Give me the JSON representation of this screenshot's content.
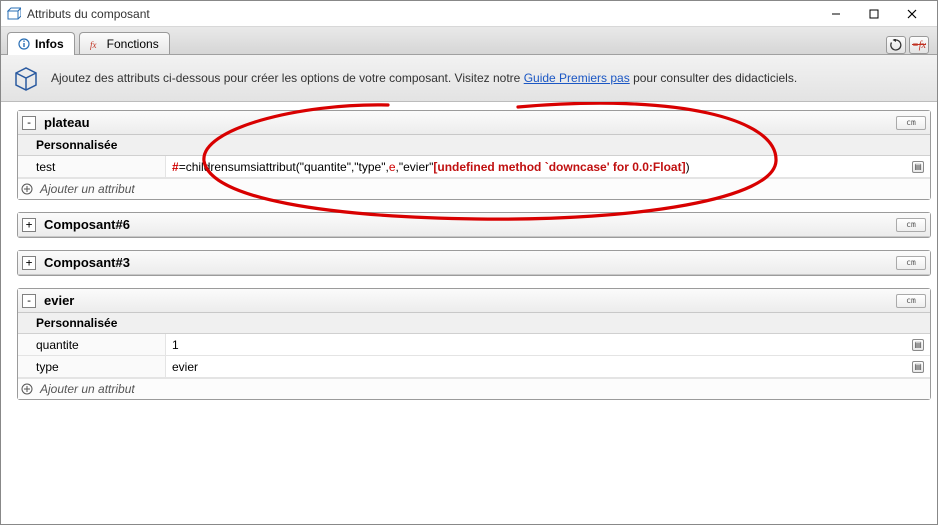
{
  "window": {
    "title": "Attributs du composant"
  },
  "tabs": {
    "infos": "Infos",
    "fonctions": "Fonctions"
  },
  "toolbar": {
    "refresh_tip": "Actualiser",
    "fx_tip": "fx"
  },
  "infobar": {
    "text_before": "Ajoutez des attributs ci-dessous pour créer les options de votre composant. Visitez notre ",
    "link": "Guide Premiers pas",
    "text_after": " pour consulter des didacticiels."
  },
  "labels": {
    "section_custom": "Personnalisée",
    "add_attr": "Ajouter un attribut",
    "unit": "cm",
    "toggle_open": "-",
    "toggle_closed": "+"
  },
  "components": {
    "plateau": {
      "name": "plateau",
      "rows": {
        "test": {
          "key": "test",
          "formula_hash": "#",
          "formula_prefix": "=childrensumsiattribut(\"quantite\",\"type\",",
          "formula_e": "e",
          "formula_mid": ",\"evier\"",
          "formula_err": "[undefined method `downcase' for 0.0:Float]",
          "formula_suffix": ")"
        }
      }
    },
    "comp6": {
      "name": "Composant#6"
    },
    "comp3": {
      "name": "Composant#3"
    },
    "evier": {
      "name": "evier",
      "rows": {
        "quantite": {
          "key": "quantite",
          "val": "1"
        },
        "type": {
          "key": "type",
          "val": "evier"
        }
      }
    }
  }
}
